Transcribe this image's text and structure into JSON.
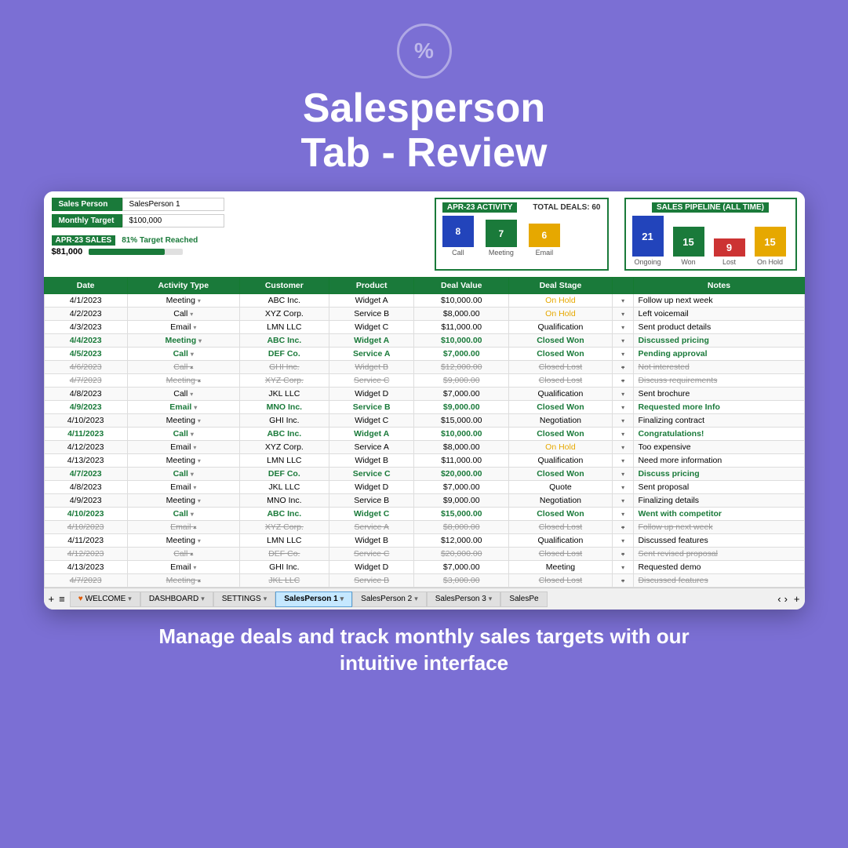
{
  "badge": {
    "icon": "%"
  },
  "title": {
    "line1": "Salesperson",
    "line2": "Tab - Review"
  },
  "bottom_text": "Manage deals and track monthly sales\ntargets with our intuitive interface",
  "spreadsheet": {
    "salesperson_label": "Sales Person",
    "salesperson_value": "SalesPerson 1",
    "monthly_target_label": "Monthly Target",
    "monthly_target_value": "$100,000",
    "sales_period": "APR-23 SALES",
    "sales_amount": "$81,000",
    "sales_target_text": "81% Target Reached",
    "progress_pct": 81,
    "activity": {
      "title": "APR-23 ACTIVITY",
      "total_deals_label": "TOTAL DEALS: 60",
      "bars": [
        {
          "label": "Call",
          "value": 8,
          "color": "#2244bb"
        },
        {
          "label": "Meeting",
          "value": 7,
          "color": "#1a7a3a"
        },
        {
          "label": "Email",
          "value": 6,
          "color": "#e6a800"
        }
      ]
    },
    "pipeline": {
      "title": "SALES PIPELINE (ALL TIME)",
      "bars": [
        {
          "label": "Ongoing",
          "value": 21,
          "color": "#2244bb"
        },
        {
          "label": "Won",
          "value": 15,
          "color": "#1a7a3a"
        },
        {
          "label": "Lost",
          "value": 9,
          "color": "#cc3333"
        },
        {
          "label": "On Hold",
          "value": 15,
          "color": "#e6a800"
        }
      ]
    },
    "table_headers": [
      "Date",
      "Activity Type",
      "Customer",
      "Product",
      "Deal Value",
      "Deal Stage",
      "",
      "Notes"
    ],
    "rows": [
      {
        "date": "4/1/2023",
        "type": "Meeting",
        "customer": "ABC Inc.",
        "product": "Widget A",
        "value": "$10,000.00",
        "stage": "On Hold",
        "notes": "Follow up next week",
        "style": "normal"
      },
      {
        "date": "4/2/2023",
        "type": "Call",
        "customer": "XYZ Corp.",
        "product": "Service B",
        "value": "$8,000.00",
        "stage": "On Hold",
        "notes": "Left voicemail",
        "style": "normal"
      },
      {
        "date": "4/3/2023",
        "type": "Email",
        "customer": "LMN LLC",
        "product": "Widget C",
        "value": "$11,000.00",
        "stage": "Qualification",
        "notes": "Sent product details",
        "style": "normal"
      },
      {
        "date": "4/4/2023",
        "type": "Meeting",
        "customer": "ABC Inc.",
        "product": "Widget A",
        "value": "$10,000.00",
        "stage": "Closed Won",
        "notes": "Discussed pricing",
        "style": "green"
      },
      {
        "date": "4/5/2023",
        "type": "Call",
        "customer": "DEF Co.",
        "product": "Service A",
        "value": "$7,000.00",
        "stage": "Closed Won",
        "notes": "Pending approval",
        "style": "green"
      },
      {
        "date": "4/6/2023",
        "type": "Call",
        "customer": "GHI Inc.",
        "product": "Widget B",
        "value": "$12,000.00",
        "stage": "Closed Lost",
        "notes": "Not interested",
        "style": "strike"
      },
      {
        "date": "4/7/2023",
        "type": "Meeting",
        "customer": "XYZ Corp.",
        "product": "Service C",
        "value": "$9,000.00",
        "stage": "Closed Lost",
        "notes": "Discuss requirements",
        "style": "strike"
      },
      {
        "date": "4/8/2023",
        "type": "Call",
        "customer": "JKL LLC",
        "product": "Widget D",
        "value": "$7,000.00",
        "stage": "Qualification",
        "notes": "Sent brochure",
        "style": "normal"
      },
      {
        "date": "4/9/2023",
        "type": "Email",
        "customer": "MNO Inc.",
        "product": "Service B",
        "value": "$9,000.00",
        "stage": "Closed Won",
        "notes": "Requested more Info",
        "style": "green"
      },
      {
        "date": "4/10/2023",
        "type": "Meeting",
        "customer": "GHI Inc.",
        "product": "Widget C",
        "value": "$15,000.00",
        "stage": "Negotiation",
        "notes": "Finalizing contract",
        "style": "normal"
      },
      {
        "date": "4/11/2023",
        "type": "Call",
        "customer": "ABC Inc.",
        "product": "Widget A",
        "value": "$10,000.00",
        "stage": "Closed Won",
        "notes": "Congratulations!",
        "style": "green"
      },
      {
        "date": "4/12/2023",
        "type": "Email",
        "customer": "XYZ Corp.",
        "product": "Service A",
        "value": "$8,000.00",
        "stage": "On Hold",
        "notes": "Too expensive",
        "style": "normal"
      },
      {
        "date": "4/13/2023",
        "type": "Meeting",
        "customer": "LMN LLC",
        "product": "Widget B",
        "value": "$11,000.00",
        "stage": "Qualification",
        "notes": "Need more information",
        "style": "normal"
      },
      {
        "date": "4/7/2023",
        "type": "Call",
        "customer": "DEF Co.",
        "product": "Service C",
        "value": "$20,000.00",
        "stage": "Closed Won",
        "notes": "Discuss pricing",
        "style": "green"
      },
      {
        "date": "4/8/2023",
        "type": "Email",
        "customer": "JKL LLC",
        "product": "Widget D",
        "value": "$7,000.00",
        "stage": "Quote",
        "notes": "Sent proposal",
        "style": "normal"
      },
      {
        "date": "4/9/2023",
        "type": "Meeting",
        "customer": "MNO Inc.",
        "product": "Service B",
        "value": "$9,000.00",
        "stage": "Negotiation",
        "notes": "Finalizing details",
        "style": "normal"
      },
      {
        "date": "4/10/2023",
        "type": "Call",
        "customer": "ABC Inc.",
        "product": "Widget C",
        "value": "$15,000.00",
        "stage": "Closed Won",
        "notes": "Went with competitor",
        "style": "green"
      },
      {
        "date": "4/10/2023",
        "type": "Email",
        "customer": "XYZ Corp.",
        "product": "Service A",
        "value": "$8,000.00",
        "stage": "Closed Lost",
        "notes": "Follow up next week",
        "style": "strike"
      },
      {
        "date": "4/11/2023",
        "type": "Meeting",
        "customer": "LMN LLC",
        "product": "Widget B",
        "value": "$12,000.00",
        "stage": "Qualification",
        "notes": "Discussed features",
        "style": "normal"
      },
      {
        "date": "4/12/2023",
        "type": "Call",
        "customer": "DEF Co.",
        "product": "Service C",
        "value": "$20,000.00",
        "stage": "Closed Lost",
        "notes": "Sent revised proposal",
        "style": "strike"
      },
      {
        "date": "4/13/2023",
        "type": "Email",
        "customer": "GHI Inc.",
        "product": "Widget D",
        "value": "$7,000.00",
        "stage": "Meeting",
        "notes": "Requested demo",
        "style": "normal"
      },
      {
        "date": "4/7/2023",
        "type": "Meeting",
        "customer": "JKL LLC",
        "product": "Service B",
        "value": "$3,000.00",
        "stage": "Closed Lost",
        "notes": "Discussed features",
        "style": "strike"
      }
    ],
    "tabs": [
      {
        "label": "WELCOME",
        "active": false
      },
      {
        "label": "DASHBOARD",
        "active": false
      },
      {
        "label": "SETTINGS",
        "active": false
      },
      {
        "label": "SalesPerson 1",
        "active": true
      },
      {
        "label": "SalesPerson 2",
        "active": false
      },
      {
        "label": "SalesPerson 3",
        "active": false
      },
      {
        "label": "SalesPe...",
        "active": false
      }
    ]
  }
}
